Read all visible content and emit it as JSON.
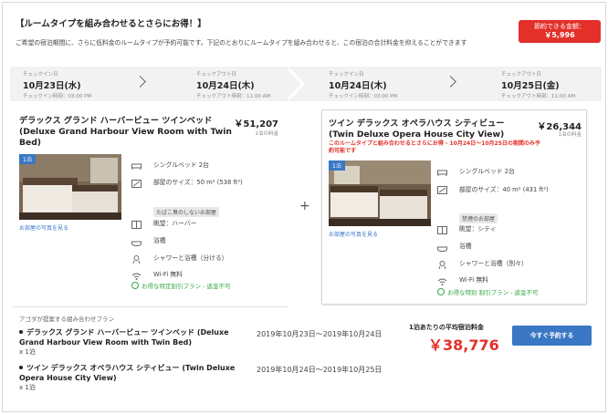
{
  "promo": {
    "title": "【ルームタイプを組み合わせるとさらにお得！】",
    "text": "ご希望の宿泊期間に、さらに低料金のルームタイプが予約可能です。下記のとおりにルームタイプを組み合わせると、この宿泊の合計料金を抑えることができます",
    "savings_label": "節約できる金額：",
    "savings_amount": "￥5,996"
  },
  "dates": {
    "seg1": {
      "checkin_label": "チェックイン日",
      "checkin_date": "10月23日(水)",
      "checkin_time": "チェックイン時刻：03:00 PM",
      "checkout_label": "チェックアウト日",
      "checkout_date": "10月24日(木)",
      "checkout_time": "チェックアウト時刻：11:00 AM"
    },
    "seg2": {
      "checkin_label": "チェックイン日",
      "checkin_date": "10月24日(木)",
      "checkin_time": "チェックイン時刻：03:00 PM",
      "checkout_label": "チェックアウト日",
      "checkout_date": "10月25日(金)",
      "checkout_time": "チェックアウト時刻：11:00 AM"
    }
  },
  "room1": {
    "name_jp": "デラックス グランド ハーバービュー ツインベッド",
    "name_en": "(Deluxe Grand Harbour View Room with Twin Bed)",
    "price": "￥51,207",
    "per_stay": "1泊の料金",
    "nights_tag": "1泊",
    "photo_link": "お部屋の写真を見る",
    "bed": "シングルベッド 2台",
    "size": "部屋のサイズ：50 m² (538 ft²)",
    "smoking_tag": "たばこ臭のしないお部屋",
    "view": "眺望：ハーバー",
    "bath": "浴槽",
    "shower": "シャワーと浴槽（分ける）",
    "wifi": "Wi-Fi 無料",
    "deal": "お得な特定割引プラン - 返金不可"
  },
  "room2": {
    "name_jp": "ツイン デラックス オペラハウス シティビュー",
    "name_en": "(Twin Deluxe Opera House City View)",
    "price": "￥26,344",
    "per_stay": "1泊の料金",
    "warning": "このルームタイプと組み合わせるとさらにお得 - 10月24日～10月25日の期間のみ予約可能です",
    "nights_tag": "1泊",
    "photo_link": "お部屋の写真を見る",
    "bed": "シングルベッド 2台",
    "size": "部屋のサイズ：40 m² (431 ft²)",
    "smoking_tag": "禁煙のお部屋",
    "view": "眺望：シティ",
    "bath": "浴槽",
    "shower": "シャワーと浴槽（別々）",
    "wifi": "Wi-Fi 無料",
    "deal": "お得な特別 割引プラン - 返金不可"
  },
  "plus_sign": "+",
  "summary": {
    "heading": "アゴダが提案する組み合わせプラン",
    "items": [
      {
        "name": "デラックス グランド ハーバービュー ツインベッド (Deluxe Grand Harbour View Room with Twin Bed)",
        "qty": "x 1泊",
        "dates": "2019年10月23日～2019年10月24日"
      },
      {
        "name": "ツイン デラックス オペラハウス シティビュー (Twin Deluxe Opera House City View)",
        "qty": "x 1泊",
        "dates": "2019年10月24日～2019年10月25日"
      }
    ],
    "avg_label": "1泊あたりの平均宿泊料金",
    "avg_price": "￥38,776",
    "book_button": "今すぐ予約する"
  },
  "colors": {
    "accent_red": "#e3302a",
    "link_blue": "#3a77c4",
    "deal_green": "#35a845"
  }
}
